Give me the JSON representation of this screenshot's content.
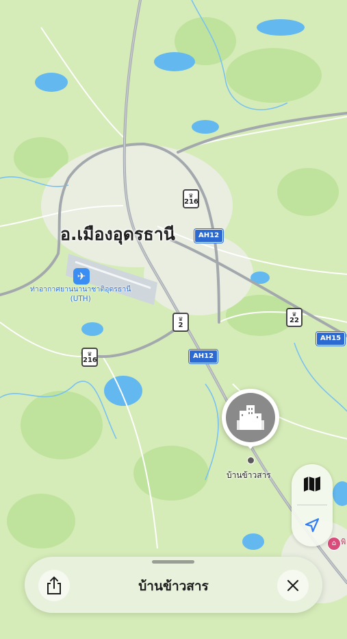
{
  "map": {
    "city_label": "อ.เมืองอุดรธานี",
    "airport": {
      "icon": "airplane-icon",
      "name_line1": "ท่าอากาศยานนานาชาติอุดรธานี",
      "name_line2": "(UTH)"
    },
    "highway_shields": {
      "r216_top": "216",
      "r216_left": "216",
      "r2": "2",
      "r22": "22"
    },
    "asian_highway_shields": {
      "ah12_top": "AH12",
      "ah12_mid": "AH12",
      "ah15": "AH15"
    },
    "selected_place": {
      "label": "บ้านข้าวสาร",
      "icon": "city-buildings-icon",
      "colors": {
        "pin_fill": "#8a8a8a"
      }
    },
    "poi": {
      "icon": "museum-icon",
      "label": "พิ"
    },
    "colors": {
      "land": "#d6ecb8",
      "water": "#63b8ef",
      "road_major": "#9aa0a6",
      "park": "#b7dd94"
    }
  },
  "controls": {
    "map_mode_icon": "map-icon",
    "location_icon": "location-arrow-icon"
  },
  "sheet": {
    "title": "บ้านข้าวสาร",
    "share_icon": "share-icon",
    "close_icon": "close-icon"
  }
}
